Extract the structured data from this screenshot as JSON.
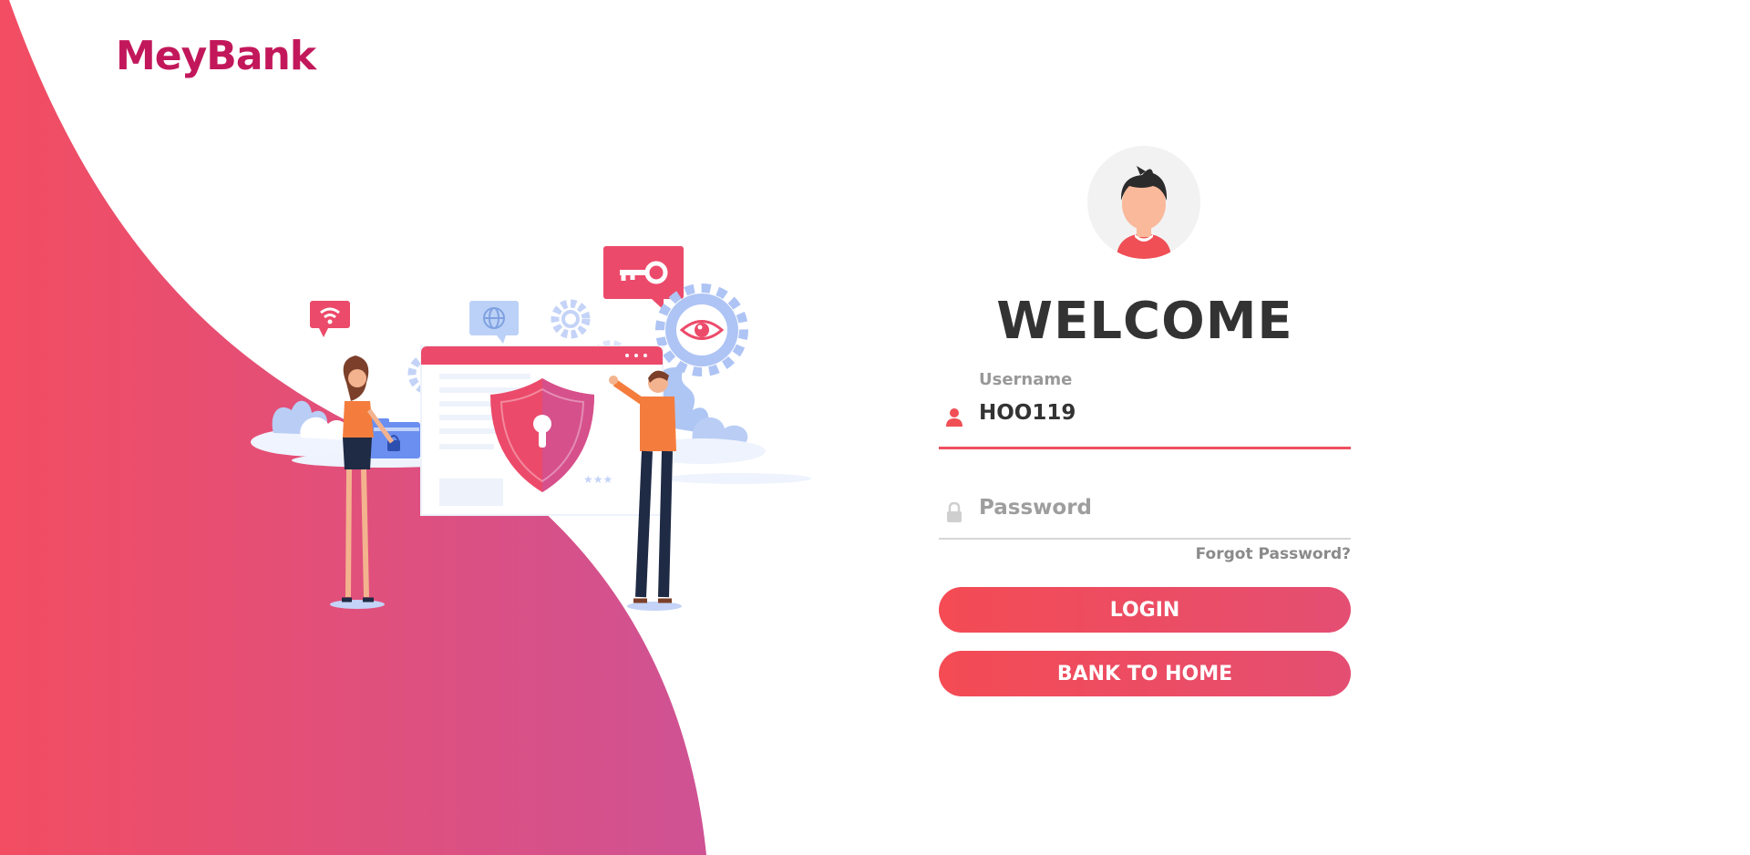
{
  "brand": {
    "logo_text": "MeyBank",
    "color": "#c2185b"
  },
  "background": {
    "gradient_start": "#f24d62",
    "gradient_end": "#d1528f"
  },
  "login": {
    "welcome": "WELCOME",
    "username": {
      "label": "Username",
      "value": "HOO119",
      "icon": "user-icon"
    },
    "password": {
      "placeholder": "Password",
      "value": "",
      "icon": "lock-icon"
    },
    "forgot_password": "Forgot Password?",
    "login_button": "LOGIN",
    "home_button": "BANK TO HOME",
    "accent_color": "#ef5161"
  },
  "illustration": {
    "subject": "security-shield-scene"
  }
}
